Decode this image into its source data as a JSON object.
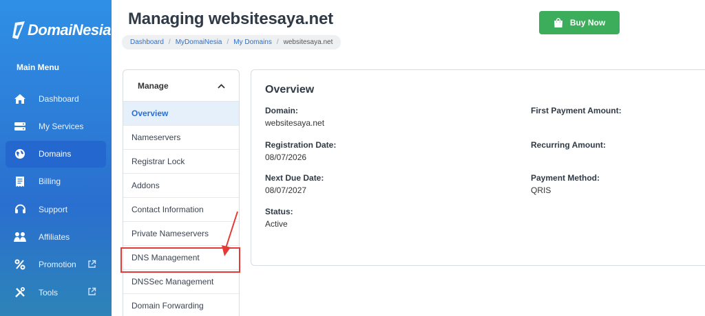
{
  "sidebar": {
    "logo": "DomaiNesia",
    "main_menu_label": "Main Menu",
    "items": [
      {
        "label": "Dashboard",
        "icon": "home-icon"
      },
      {
        "label": "My Services",
        "icon": "server-icon"
      },
      {
        "label": "Domains",
        "icon": "globe-icon",
        "active": true
      },
      {
        "label": "Billing",
        "icon": "billing-icon"
      },
      {
        "label": "Support",
        "icon": "headset-icon"
      },
      {
        "label": "Affiliates",
        "icon": "affiliates-icon"
      },
      {
        "label": "Promotion",
        "icon": "percent-icon",
        "external": true
      },
      {
        "label": "Tools",
        "icon": "tools-icon",
        "external": true
      }
    ]
  },
  "header": {
    "title": "Managing websitesaya.net",
    "breadcrumb": [
      "Dashboard",
      "MyDomaiNesia",
      "My Domains",
      "websitesaya.net"
    ],
    "buy_button": "Buy Now"
  },
  "manage": {
    "title": "Manage",
    "items": [
      "Overview",
      "Nameservers",
      "Registrar Lock",
      "Addons",
      "Contact Information",
      "Private Nameservers",
      "DNS Management",
      "DNSSec Management",
      "Domain Forwarding"
    ]
  },
  "overview": {
    "title": "Overview",
    "domain_label": "Domain:",
    "domain_value": "websitesaya.net",
    "registration_label": "Registration Date:",
    "registration_value": "08/07/2026",
    "next_due_label": "Next Due Date:",
    "next_due_value": "08/07/2027",
    "status_label": "Status:",
    "status_value": "Active",
    "first_payment_label": "First Payment Amount:",
    "recurring_label": "Recurring Amount:",
    "payment_method_label": "Payment Method:",
    "payment_method_value": "QRIS"
  },
  "colors": {
    "sidebar": "#2d7fd8",
    "active_menu": "#2467cf",
    "buy_button": "#3cae5b",
    "highlight": "#e53935",
    "link": "#2a6fcf"
  }
}
